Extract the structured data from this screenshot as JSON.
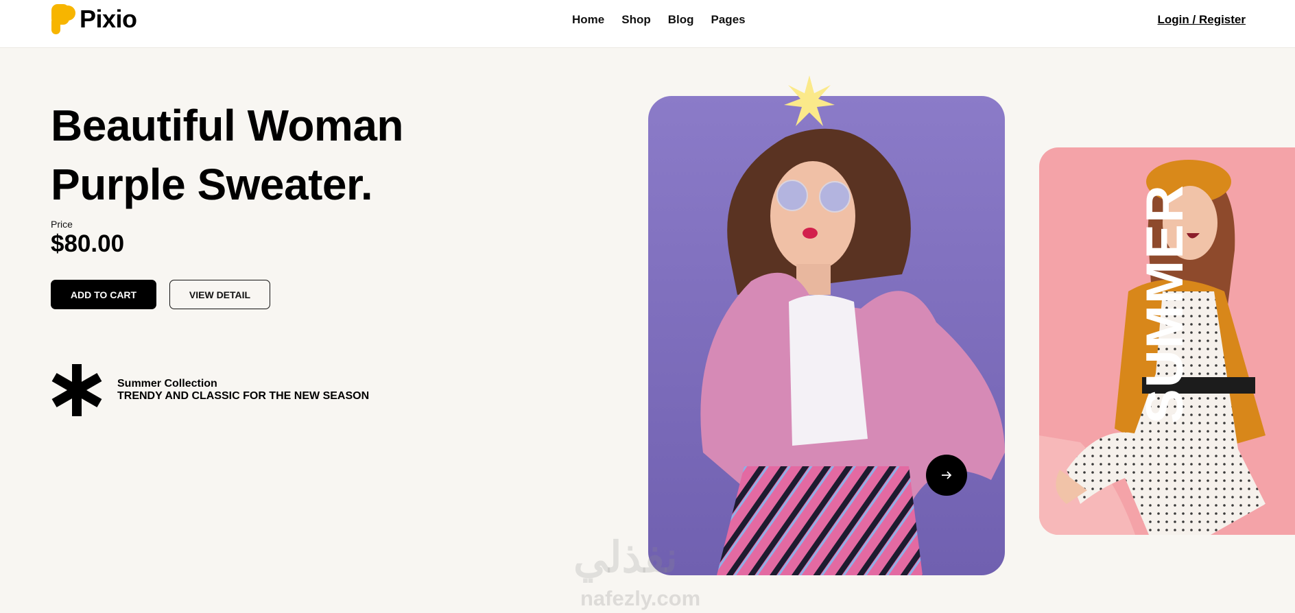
{
  "brand": {
    "name": "Pixio",
    "accent": "#f7b500"
  },
  "nav": {
    "items": [
      "Home",
      "Shop",
      "Blog",
      "Pages"
    ],
    "login": "Login / Register"
  },
  "hero": {
    "title_line1": "Beautiful Woman",
    "title_line2": "Purple Sweater.",
    "price_label": "Price",
    "price": "$80.00",
    "add_to_cart": "ADD TO CART",
    "view_detail": "VIEW DETAIL",
    "collection_title": "Summer Collection",
    "collection_subtitle": "TRENDY AND CLASSIC FOR THE NEW SEASON"
  },
  "slides": {
    "main_bg": "#8a78c4",
    "side_bg": "#f4a3a8",
    "side_text": "SUMMER",
    "star_color": "#fbe98a"
  },
  "watermark": {
    "arabic": "نفذلي",
    "latin": "nafezly.com"
  }
}
